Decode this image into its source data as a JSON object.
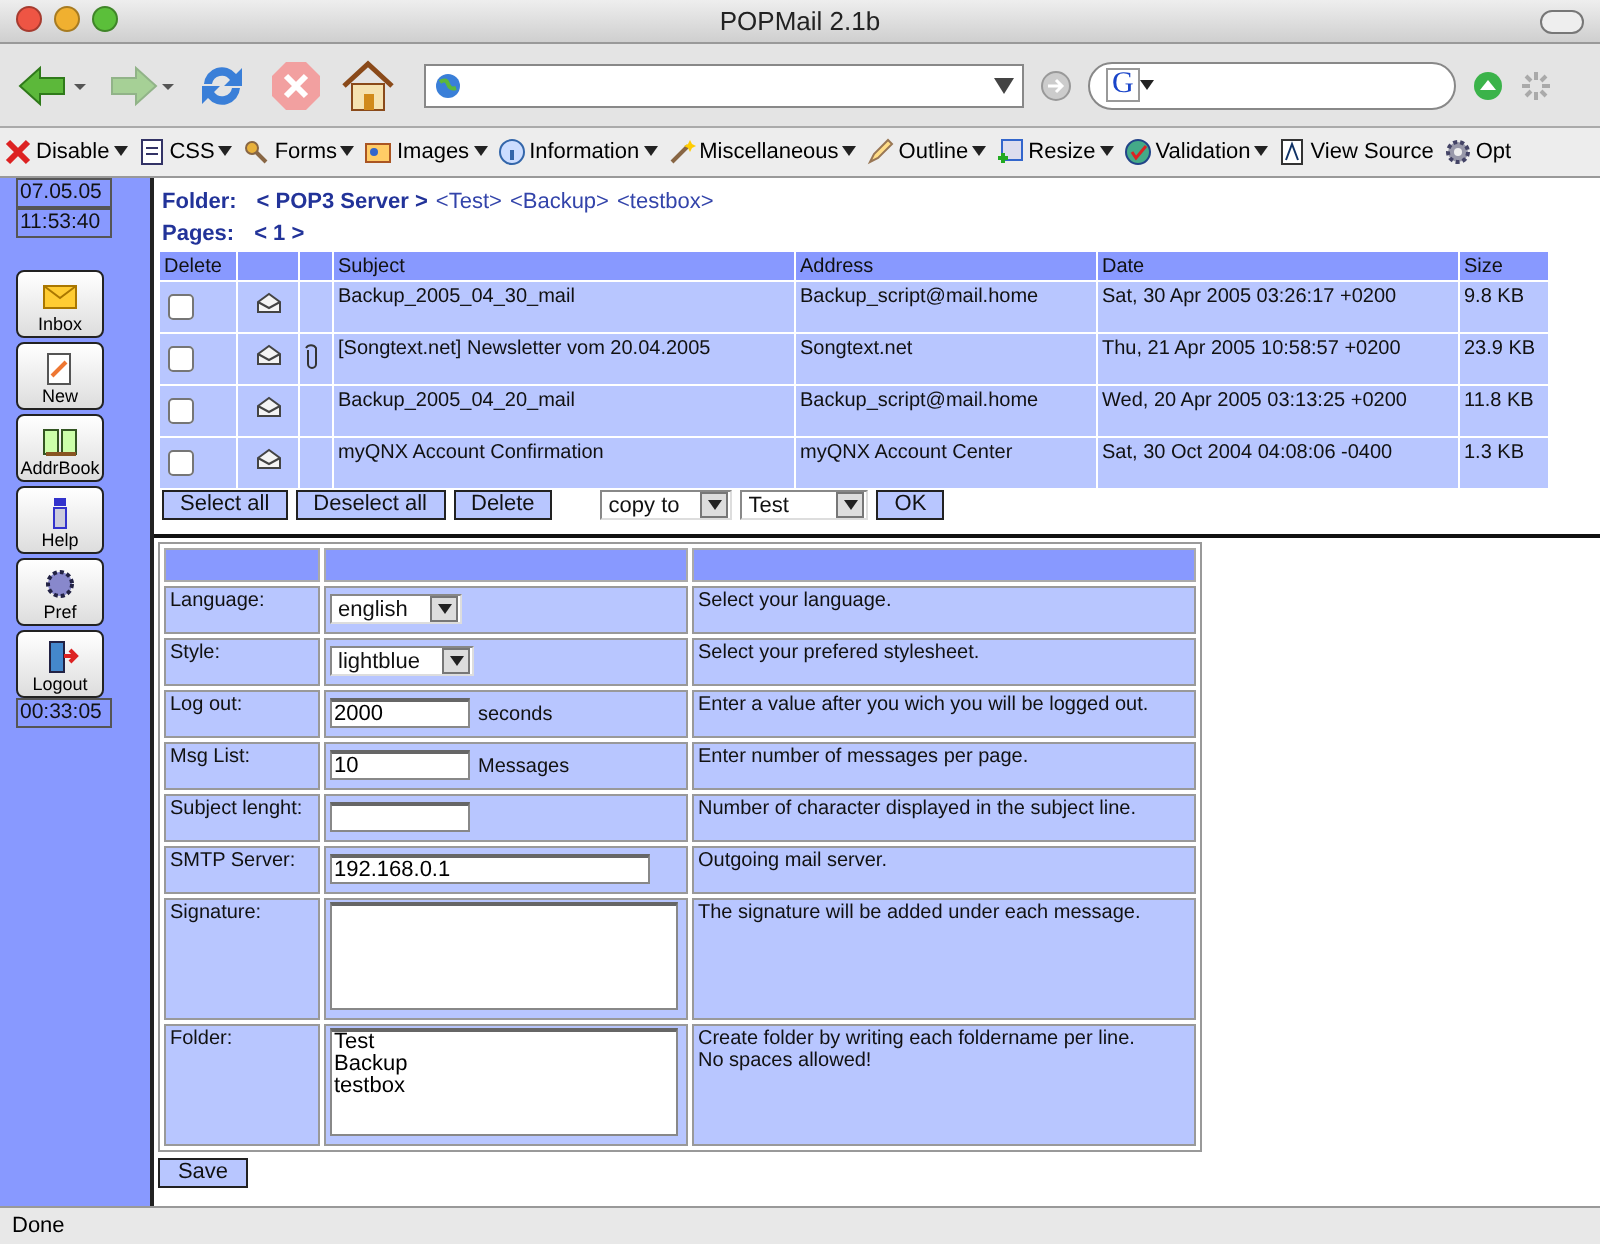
{
  "window": {
    "title": "POPMail 2.1b"
  },
  "search": {
    "engine_letter": "G"
  },
  "dev_toolbar": [
    {
      "label": "Disable",
      "menu": true
    },
    {
      "label": "CSS",
      "menu": true
    },
    {
      "label": "Forms",
      "menu": true
    },
    {
      "label": "Images",
      "menu": true
    },
    {
      "label": "Information",
      "menu": true
    },
    {
      "label": "Miscellaneous",
      "menu": true
    },
    {
      "label": "Outline",
      "menu": true
    },
    {
      "label": "Resize",
      "menu": true
    },
    {
      "label": "Validation",
      "menu": true
    },
    {
      "label": "View Source",
      "menu": false
    },
    {
      "label": "Opt",
      "menu": false
    }
  ],
  "sidebar": {
    "date": "07.05.05",
    "time": "11:53:40",
    "buttons": [
      "Inbox",
      "New",
      "AddrBook",
      "Help",
      "Pref",
      "Logout"
    ],
    "timer": "00:33:05"
  },
  "folder": {
    "label": "Folder:",
    "current": "< POP3 Server >",
    "links": [
      "<Test>",
      "<Backup>",
      "<testbox>"
    ]
  },
  "pages": {
    "label": "Pages:",
    "current": "< 1 >"
  },
  "messages": {
    "columns": [
      "Delete",
      "Subject",
      "Address",
      "Date",
      "Size"
    ],
    "rows": [
      {
        "checked": false,
        "attachment": false,
        "subject": "Backup_2005_04_30_mail",
        "address": "Backup_script@mail.home",
        "date": "Sat, 30 Apr 2005 03:26:17 +0200",
        "size": "9.8 KB"
      },
      {
        "checked": false,
        "attachment": true,
        "subject": "[Songtext.net] Newsletter vom 20.04.2005",
        "address": "Songtext.net",
        "date": "Thu, 21 Apr 2005 10:58:57 +0200",
        "size": "23.9 KB"
      },
      {
        "checked": false,
        "attachment": false,
        "subject": "Backup_2005_04_20_mail",
        "address": "Backup_script@mail.home",
        "date": "Wed, 20 Apr 2005 03:13:25 +0200",
        "size": "11.8 KB"
      },
      {
        "checked": false,
        "attachment": false,
        "subject": "myQNX Account Confirmation",
        "address": "myQNX Account Center",
        "date": "Sat, 30 Oct 2004 04:08:06 -0400",
        "size": "1.3 KB"
      }
    ]
  },
  "actions": {
    "buttons": [
      "Select all",
      "Deselect all",
      "Delete"
    ],
    "copy_select": "copy to",
    "folder_select": "Test",
    "ok": "OK"
  },
  "preferences": {
    "rows": [
      {
        "kind": "select",
        "label": "Language:",
        "value": "english",
        "description": "Select your language."
      },
      {
        "kind": "select",
        "label": "Style:",
        "value": "lightblue",
        "description": "Select your prefered stylesheet."
      },
      {
        "kind": "input",
        "label": "Log out:",
        "value": "2000",
        "unit": "seconds",
        "description": "Enter a value after you wich you will be logged out."
      },
      {
        "kind": "input",
        "label": "Msg List:",
        "value": "10",
        "unit": "Messages",
        "description": "Enter number of messages per page."
      },
      {
        "kind": "input",
        "label": "Subject lenght:",
        "value": "",
        "description": "Number of character displayed in the subject line."
      },
      {
        "kind": "wide",
        "label": "SMTP Server:",
        "value": "192.168.0.1",
        "description": "Outgoing mail server."
      },
      {
        "kind": "textarea",
        "label": "Signature:",
        "value": "",
        "description": "The signature will be added under each message."
      },
      {
        "kind": "textarea",
        "label": "Folder:",
        "value": "Test\nBackup\ntestbox",
        "description": "Create folder by writing each foldername per line.\nNo spaces allowed!"
      }
    ],
    "save": "Save"
  },
  "status_bar": {
    "text": "Done"
  }
}
